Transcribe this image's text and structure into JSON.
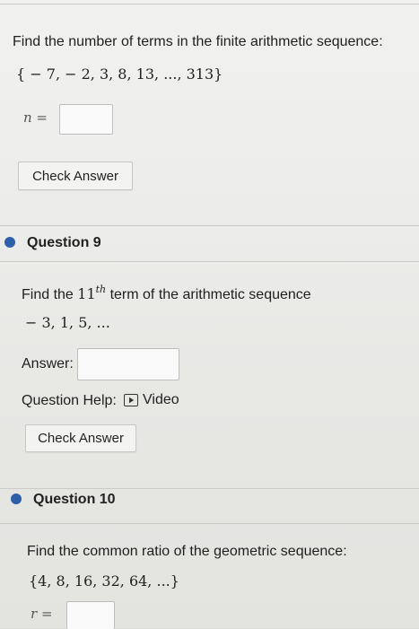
{
  "q8": {
    "prompt": "Find the number of terms in the finite arithmetic sequence:",
    "sequence": "{ − 7,  − 2, 3, 8, 13, ..., 313}",
    "var_label": "n =",
    "answer_value": "",
    "check_button": "Check Answer"
  },
  "q9": {
    "title": "Question 9",
    "prompt_before": "Find the ",
    "ordinal_num": "11",
    "ordinal_sup": "th",
    "prompt_after": " term of the arithmetic sequence",
    "sequence": "− 3, 1, 5, ...",
    "answer_label": "Answer:",
    "answer_value": "",
    "help_label": "Question Help:",
    "video_label": "Video",
    "check_button": "Check Answer"
  },
  "q10": {
    "title": "Question 10",
    "prompt": "Find the common ratio of the geometric sequence:",
    "sequence": "{4, 8, 16, 32, 64, ...}",
    "var_label": "r ="
  },
  "colors": {
    "accent": "#2f5fa8",
    "background": "#ececea"
  },
  "icons": {
    "video": "play-video-icon",
    "bullet": "question-bullet-icon"
  }
}
